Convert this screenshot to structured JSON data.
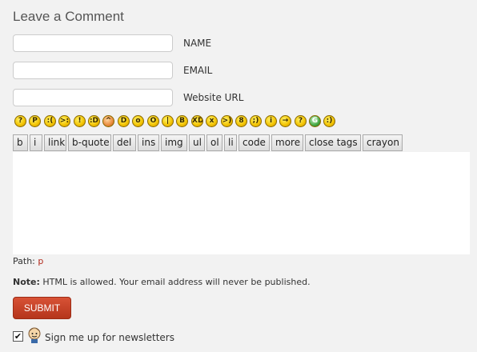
{
  "heading": "Leave a Comment",
  "fields": [
    {
      "label": "NAME",
      "value": ""
    },
    {
      "label": "EMAIL",
      "value": ""
    },
    {
      "label": "Website URL",
      "value": ""
    }
  ],
  "smileys": [
    {
      "name": "question-smiley-icon",
      "glyph": "?"
    },
    {
      "name": "tongue-smiley-icon",
      "glyph": "P"
    },
    {
      "name": "sad-smiley-icon",
      "glyph": ":("
    },
    {
      "name": "evil-smiley-icon",
      "glyph": ">:"
    },
    {
      "name": "exclaim-smiley-icon",
      "glyph": "!"
    },
    {
      "name": "grin-smiley-icon",
      "glyph": ":D"
    },
    {
      "name": "blush-smiley-icon",
      "glyph": "^"
    },
    {
      "name": "biggrin-smiley-icon",
      "glyph": "D"
    },
    {
      "name": "surprised-smiley-icon",
      "glyph": "o"
    },
    {
      "name": "eek-smiley-icon",
      "glyph": "O"
    },
    {
      "name": "neutral-smiley-icon",
      "glyph": "|"
    },
    {
      "name": "cool-smiley-icon",
      "glyph": "B"
    },
    {
      "name": "lol-smiley-icon",
      "glyph": "XD"
    },
    {
      "name": "mad-smiley-icon",
      "glyph": "x"
    },
    {
      "name": "twisted-smiley-icon",
      "glyph": ">)"
    },
    {
      "name": "rolleyes-smiley-icon",
      "glyph": "8"
    },
    {
      "name": "wink-smiley-icon",
      "glyph": ";)"
    },
    {
      "name": "idea-smiley-icon",
      "glyph": "i"
    },
    {
      "name": "arrow-smiley-icon",
      "glyph": "→"
    },
    {
      "name": "confused-smiley-icon",
      "glyph": "?"
    },
    {
      "name": "mrgreen-smiley-icon",
      "glyph": "G"
    },
    {
      "name": "smile-smiley-icon",
      "glyph": ":)"
    }
  ],
  "toolbar": [
    "b",
    "i",
    "link",
    "b-quote",
    "del",
    "ins",
    "img",
    "ul",
    "ol",
    "li",
    "code",
    "more",
    "close tags",
    "crayon"
  ],
  "comment_text": "",
  "path": {
    "label": "Path:",
    "value": "p"
  },
  "note": {
    "bold": "Note:",
    "text": "HTML is allowed. Your email address will never be published."
  },
  "submit_label": "SUBMIT",
  "newsletter": {
    "checked": true,
    "label": "Sign me up for newsletters",
    "check_glyph": "✔"
  },
  "colors": {
    "submit": "#c2401f",
    "path_value": "#b2291b",
    "background": "#f2f2f2"
  }
}
